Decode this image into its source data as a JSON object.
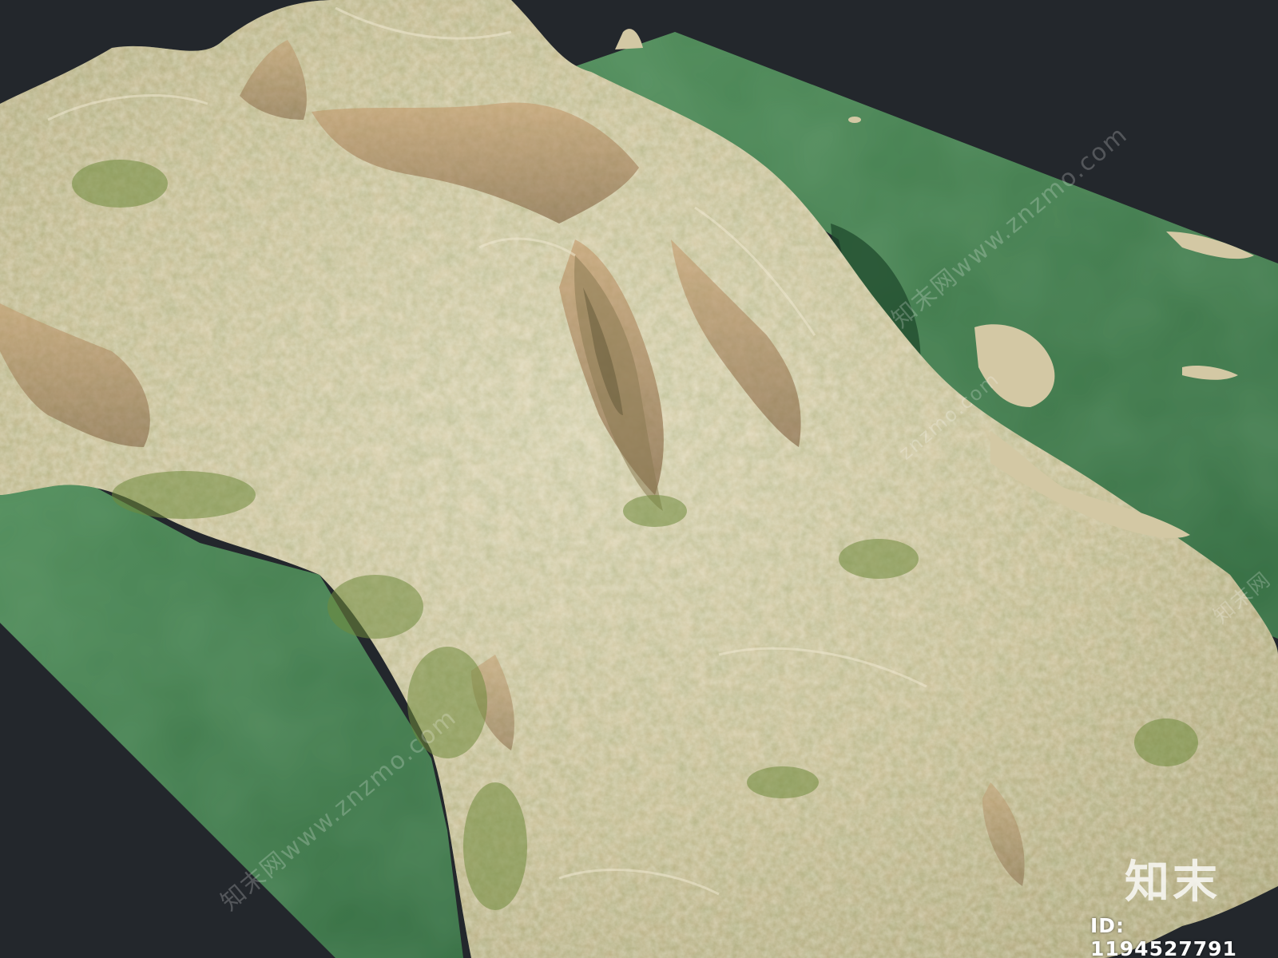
{
  "scene": {
    "background_color": "#23272c",
    "water_color": "#3f7a4b",
    "terrain_light_color": "#d9cfae",
    "terrain_green_color": "#7a8a4a",
    "cliff_color": "#b0845a"
  },
  "watermark": {
    "diagonal_text_1": "知末网www.znzmo.com",
    "diagonal_text_2": "知末网www.znzmo.com",
    "diagonal_text_3": "znzmo.com",
    "diagonal_text_4": "知末网",
    "logo_text": "知末",
    "id_text": "ID: 1194527791"
  }
}
